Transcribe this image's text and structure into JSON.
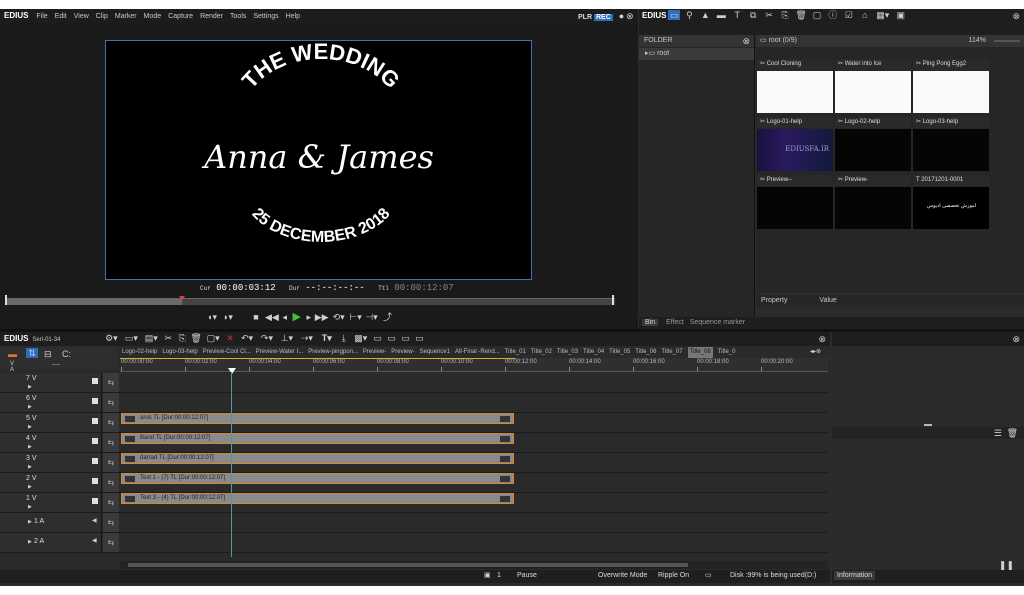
{
  "player": {
    "app_name": "EDIUS",
    "menu": [
      "File",
      "Edit",
      "View",
      "Clip",
      "Marker",
      "Mode",
      "Capture",
      "Render",
      "Tools",
      "Settings",
      "Help"
    ],
    "plr": "PLR",
    "rec": "REC",
    "cur_label": "Cur",
    "cur_value": "00:00:03:12",
    "dur_label": "Dur",
    "dur_value": "--:--:--:--",
    "ttl_label": "Ttl",
    "ttl_value": "00:00:12:07",
    "scrub_position": 0.29
  },
  "preview": {
    "line1": "THE WEDDING",
    "line2": "Anna  & James",
    "line3": "25 DECEMBER 2018"
  },
  "bin": {
    "app_name": "EDIUS",
    "folder_label": "FOLDER",
    "tree_root": "root",
    "path": "root (0/9)",
    "zoom": "114%",
    "items": [
      {
        "name": "Cool Cloning",
        "kind": "white"
      },
      {
        "name": "Water into Ice",
        "kind": "white"
      },
      {
        "name": "Ping Pong Egg2",
        "kind": "white"
      },
      {
        "name": "Logo-01-help",
        "kind": "logo"
      },
      {
        "name": "Logo-02-help",
        "kind": "black"
      },
      {
        "name": "Logo-03-help",
        "kind": "black"
      },
      {
        "name": "Preview--",
        "kind": "black"
      },
      {
        "name": "Preview-",
        "kind": "black"
      },
      {
        "name": "20171201-0001",
        "kind": "title"
      }
    ],
    "logo_text": "EDIUSFA.IR",
    "title_thumb_text": "اموزش تخصصی ادیوس",
    "property_label": "Property",
    "value_label": "Value",
    "tabs": [
      "Bin",
      "Effect",
      "Sequence marker"
    ]
  },
  "timeline": {
    "app_name": "EDIUS",
    "sequence": "Seri-01-34",
    "tabs": [
      "Logo-02-help",
      "Logo-03-help",
      "Preview-Cool Cl...",
      "Preview-Water I...",
      "Preview-pingpon...",
      "Preview-",
      "Preview-",
      "Sequence1",
      "All-Final -Rend...",
      "Title_01",
      "Title_02",
      "Title_03",
      "Title_04",
      "Title_05",
      "Title_06",
      "Title_07",
      "Title_08",
      "Title_0"
    ],
    "selected_tab": "Title_08",
    "ruler": [
      "00:00:00:00",
      "00:00:02:00",
      "00:00:04:00",
      "00:00:06:00",
      "00:00:08:00",
      "00:00:10:00",
      "00:00:12:00",
      "00:00:14:00",
      "00:00:16:00",
      "00:00:18:00",
      "00:00:20:00"
    ],
    "tracks": [
      "7 V",
      "6 V",
      "5 V",
      "4 V",
      "3 V",
      "2 V",
      "1 V",
      "1 A",
      "2 A"
    ],
    "clips": [
      {
        "track": "6 V",
        "label": "arus  TL [Dur:00:00:12:07]"
      },
      {
        "track": "5 V",
        "label": "Band  TL [Dur:00:00:12:07]"
      },
      {
        "track": "4 V",
        "label": "darrad  TL [Dur:00:00:12:07]"
      },
      {
        "track": "3 V",
        "label": "Text 1 - (7)  TL [Dur:00:00:12:07]"
      },
      {
        "track": "2 V",
        "label": "Text 3 - (4)  TL [Dur:00:00:12:07]"
      }
    ],
    "va_v": "V",
    "va_a": "A",
    "va_dash": "----"
  },
  "status": {
    "count": "1",
    "state": "Pause",
    "mode": "Overwrite Mode",
    "ripple": "Ripple On",
    "disk": "Disk :99% is being used(D:)",
    "info_tab": "Information"
  }
}
